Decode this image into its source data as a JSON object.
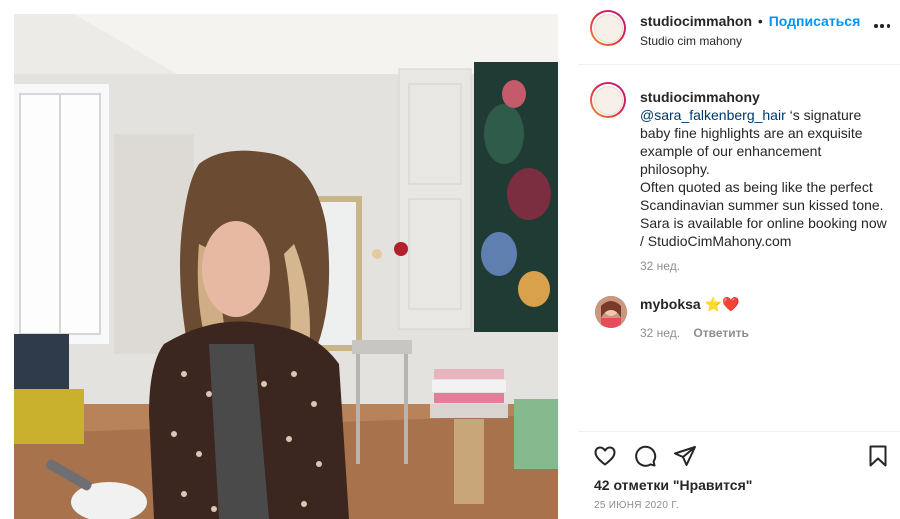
{
  "post": {
    "image_alt": "Stylist in salon interior"
  },
  "header": {
    "username": "studiocimmahon",
    "separator": "•",
    "follow_label": "Подписаться",
    "location": "Studio cim mahony",
    "more_icon": "more-horizontal-icon"
  },
  "caption": {
    "username": "studiocimmahony",
    "mention": "@sara_falkenberg_hair",
    "first_line_rest": " ‘s signature",
    "lines": [
      "baby fine highlights are an exquisite",
      "example of our enhancement",
      "philosophy.",
      "Often quoted as being like the perfect",
      "Scandinavian summer sun kissed tone.",
      "Sara is available for online booking now",
      "/ StudioCimMahony.com"
    ],
    "time": "32 нед."
  },
  "comment": {
    "username": "myboksa",
    "emoji_star": "⭐",
    "emoji_heart": "❤️",
    "time": "32 нед.",
    "reply_label": "Ответить"
  },
  "actions": {
    "like_icon": "heart-icon",
    "comment_icon": "comment-icon",
    "share_icon": "share-icon",
    "save_icon": "bookmark-icon",
    "likes_text": "42 отметки \"Нравится\"",
    "date": "25 ИЮНЯ 2020 Г."
  },
  "colors": {
    "follow_blue": "#0095f6",
    "mention_blue": "#00376b",
    "muted_gray": "#8e8e8e",
    "text": "#262626"
  }
}
